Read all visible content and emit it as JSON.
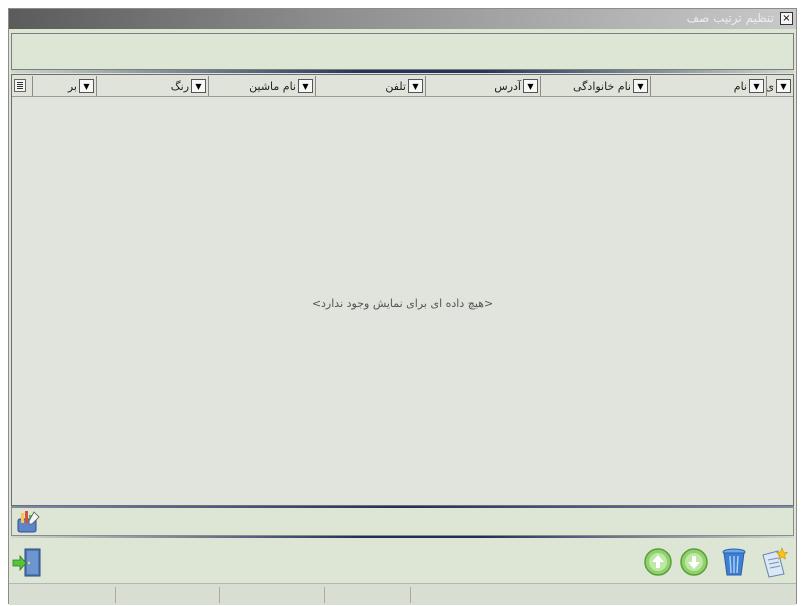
{
  "window": {
    "title": "تنظیم ترتیب صف",
    "close_label": "×"
  },
  "grid": {
    "columns": [
      {
        "label": "ی",
        "dropdown": "▼"
      },
      {
        "label": "نام",
        "dropdown": "▼"
      },
      {
        "label": "نام خانوادگی",
        "dropdown": "▼"
      },
      {
        "label": "آدرس",
        "dropdown": "▼"
      },
      {
        "label": "تلفن",
        "dropdown": "▼"
      },
      {
        "label": "نام ماشین",
        "dropdown": "▼"
      },
      {
        "label": "رنگ",
        "dropdown": "▼"
      },
      {
        "label": "بر",
        "dropdown": "▼"
      }
    ],
    "empty_message": "<هیچ داده ای برای نمایش وجود ندارد>"
  },
  "icons": {
    "grid_menu": "column-chooser-icon",
    "graph": "chart-edit-icon",
    "exit": "exit-door-icon",
    "move_up": "arrow-up-circle-icon",
    "move_down": "arrow-down-circle-icon",
    "delete": "trash-can-icon",
    "new": "new-document-icon"
  },
  "colors": {
    "background": "#dde5d4",
    "accent_line": "#24345c",
    "up_down_button": "#8ed36a",
    "trash": "#3f7fd3"
  }
}
